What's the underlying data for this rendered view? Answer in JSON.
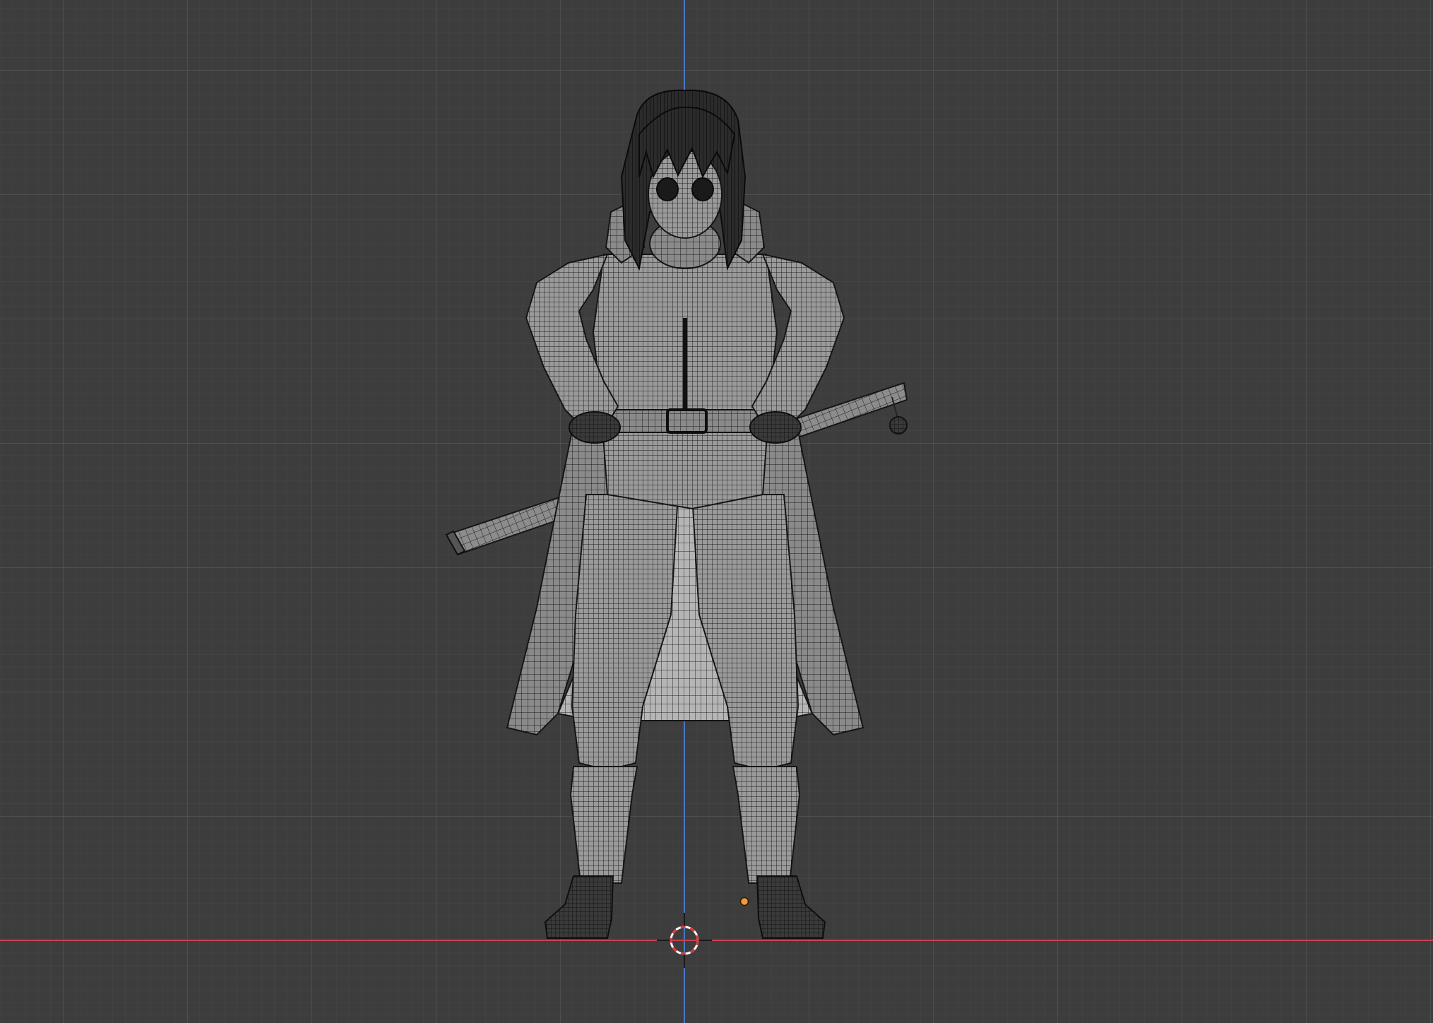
{
  "viewport": {
    "view": "front-orthographic",
    "shading": "wireframe-over-solid",
    "background_color": "#3d3d3d",
    "grid_minor_color": "#474747",
    "grid_major_color": "#545454",
    "x_axis_color": "#c8424f",
    "z_axis_color": "#4a78c8",
    "model_base_color": "#8e8e8e",
    "wire_color": "#1c1c1c",
    "origin_dot_color": "#f09a3e",
    "cursor_colors": [
      "#d83a3a",
      "#ffffff"
    ]
  },
  "scene": {
    "object": "character-model",
    "features": [
      "hair",
      "face",
      "coat",
      "belt",
      "sword",
      "boots"
    ]
  }
}
